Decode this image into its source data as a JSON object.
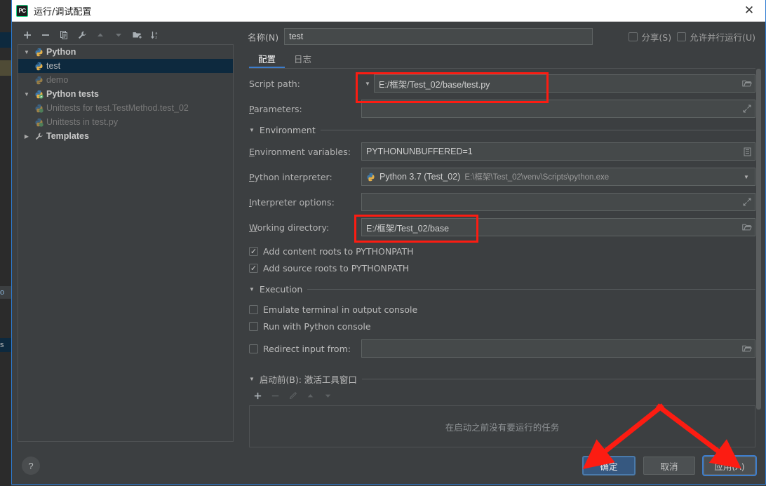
{
  "window": {
    "title": "运行/调试配置",
    "logo_text": "PC",
    "close_glyph": "✕"
  },
  "tree_toolbar": [
    {
      "name": "add",
      "glyph": "+"
    },
    {
      "name": "remove",
      "glyph": "−"
    },
    {
      "name": "copy",
      "glyph": "copy"
    },
    {
      "name": "edit-templates",
      "glyph": "wrench"
    },
    {
      "name": "move-up",
      "glyph": "▲"
    },
    {
      "name": "move-down",
      "glyph": "▼"
    },
    {
      "name": "new-folder",
      "glyph": "folder-plus"
    },
    {
      "name": "sort-alphabetically",
      "glyph": "sort-az"
    }
  ],
  "tree": {
    "items": [
      {
        "label": "Python",
        "level": 0,
        "twisty": "▼",
        "icon": "python-icon",
        "group": true,
        "selected": false,
        "dim": false
      },
      {
        "label": "test",
        "level": 1,
        "twisty": "",
        "icon": "python-icon",
        "group": false,
        "selected": true,
        "dim": false
      },
      {
        "label": "demo",
        "level": 1,
        "twisty": "",
        "icon": "python-icon",
        "group": false,
        "selected": false,
        "dim": true
      },
      {
        "label": "Python tests",
        "level": 0,
        "twisty": "▼",
        "icon": "python-test-icon",
        "group": true,
        "selected": false,
        "dim": false
      },
      {
        "label": "Unittests for test.TestMethod.test_02",
        "level": 1,
        "twisty": "",
        "icon": "python-test-icon",
        "group": false,
        "selected": false,
        "dim": true
      },
      {
        "label": "Unittests in test.py",
        "level": 1,
        "twisty": "",
        "icon": "python-test-icon",
        "group": false,
        "selected": false,
        "dim": true
      },
      {
        "label": "Templates",
        "level": 0,
        "twisty": "▶",
        "icon": "wrench-icon",
        "group": true,
        "selected": false,
        "dim": false
      }
    ]
  },
  "name_row": {
    "label": "名称(N)",
    "value": "test",
    "share": {
      "label": "分享(S)",
      "checked": false
    },
    "allow_parallel": {
      "label": "允许并行运行(U)",
      "checked": false
    }
  },
  "tabs": [
    {
      "label": "配置",
      "active": true
    },
    {
      "label": "日志",
      "active": false
    }
  ],
  "config": {
    "script_path": {
      "label": "Script path:",
      "value": "E:/框架/Test_02/base/test.py",
      "browse_glyph": "folder"
    },
    "parameters": {
      "label": "Parameters:",
      "mnemonic": "P",
      "value": "",
      "expand_glyph": "expand"
    },
    "environment_section": "Environment",
    "environment_variables": {
      "label": "Environment variables:",
      "mnemonic": "E",
      "value": "PYTHONUNBUFFERED=1",
      "browse_glyph": "list"
    },
    "python_interpreter": {
      "label": "Python interpreter:",
      "mnemonic": "P",
      "value": "Python 3.7 (Test_02)",
      "value_path": "E:\\框架\\Test_02\\venv\\Scripts\\python.exe",
      "caret_glyph": "▼"
    },
    "interpreter_options": {
      "label": "Interpreter options:",
      "mnemonic": "I",
      "value": "",
      "expand_glyph": "expand"
    },
    "working_directory": {
      "label": "Working directory:",
      "mnemonic": "W",
      "value": "E:/框架/Test_02/base",
      "browse_glyph": "folder"
    },
    "path_checkboxes": [
      {
        "label": "Add content roots to PYTHONPATH",
        "checked": true
      },
      {
        "label": "Add source roots to PYTHONPATH",
        "checked": true
      }
    ],
    "execution_section": "Execution",
    "execution_checkboxes": [
      {
        "label": "Emulate terminal in output console",
        "checked": false
      },
      {
        "label": "Run with Python console",
        "checked": false
      }
    ],
    "redirect_input": {
      "label": "Redirect input from:",
      "checked": false,
      "value": "",
      "browse_glyph": "folder"
    }
  },
  "before_launch": {
    "section_label": "启动前(B): 激活工具窗口",
    "toolbar": [
      {
        "name": "add-task",
        "glyph": "+",
        "disabled": false
      },
      {
        "name": "remove-task",
        "glyph": "−",
        "disabled": true
      },
      {
        "name": "edit-task",
        "glyph": "pencil",
        "disabled": true
      },
      {
        "name": "move-task-up",
        "glyph": "▲",
        "disabled": true
      },
      {
        "name": "move-task-down",
        "glyph": "▼",
        "disabled": true
      }
    ],
    "empty_text": "在启动之前没有要运行的任务"
  },
  "footer": {
    "help_glyph": "?",
    "ok": "确定",
    "cancel": "取消",
    "apply": "应用(A)"
  },
  "annotations": {
    "highlight_color": "#fc1c12",
    "boxes": [
      "script-path-field",
      "working-directory-field"
    ],
    "arrows": [
      "arrow-to-ok-button",
      "arrow-to-apply-button"
    ]
  },
  "colors": {
    "dialog_bg": "#3c3f41",
    "field_bg": "#45494a",
    "accent_blue": "#3d7dcc",
    "selection_blue": "#0d293e",
    "primary_button": "#365880",
    "annotation_red": "#fc1c12"
  }
}
